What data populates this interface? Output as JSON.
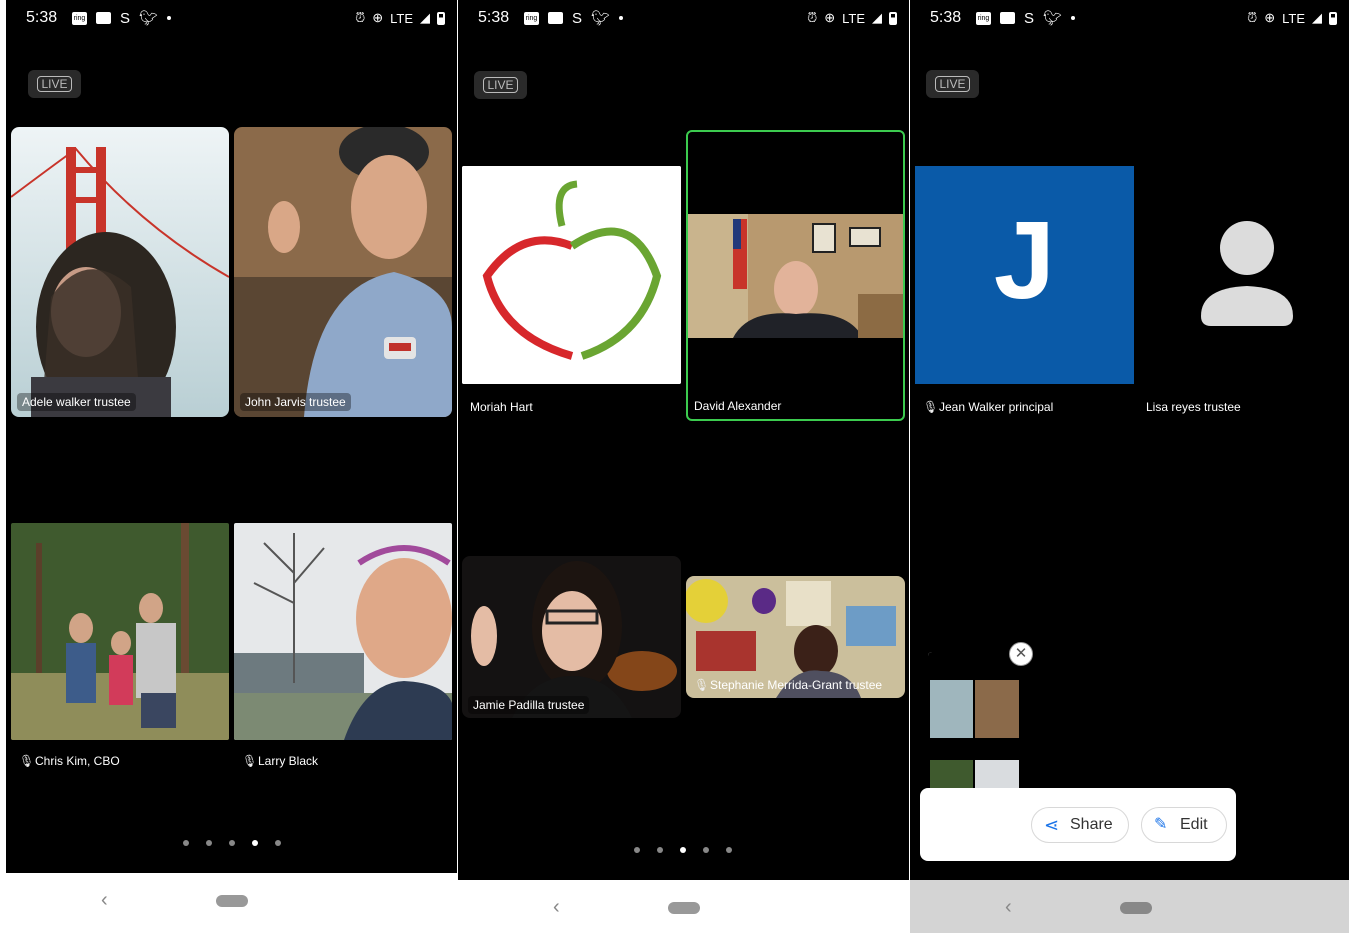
{
  "phone1": {
    "status": {
      "time": "5:38",
      "signal_text": "LTE"
    },
    "live_badge": "LIVE",
    "participants": [
      "Adele walker trustee",
      "John Jarvis trustee",
      "Chris Kim, CBO",
      "Larry Black"
    ]
  },
  "phone2": {
    "status": {
      "time": "5:38",
      "signal_text": "LTE"
    },
    "live_badge": "LIVE",
    "participants": [
      "Moriah Hart",
      "David Alexander",
      "Jamie Padilla trustee",
      "Stephanie Merrida-Grant trustee"
    ]
  },
  "phone3": {
    "status": {
      "time": "5:38",
      "signal_text": "LTE"
    },
    "live_badge": "LIVE",
    "participants": [
      "Jean Walker principal",
      "Lisa reyes trustee"
    ],
    "avatar_letter": "J",
    "screenshot_popup": {
      "share_label": "Share",
      "edit_label": "Edit"
    }
  },
  "colors": {
    "background": "#000000",
    "active_speaker_border": "#3ccb4f",
    "avatar_blue": "#0a5aa8",
    "apple_red": "#d7272b",
    "apple_green": "#6aa532"
  },
  "icons": [
    "ring-app-icon",
    "chat-icon",
    "s-icon",
    "twitter-icon",
    "alarm-icon",
    "data-saver-icon",
    "signal-icon",
    "battery-icon",
    "muted-mic-icon",
    "share-icon",
    "pencil-icon",
    "close-icon",
    "back-icon",
    "home-pill-icon",
    "generic-person-icon"
  ]
}
